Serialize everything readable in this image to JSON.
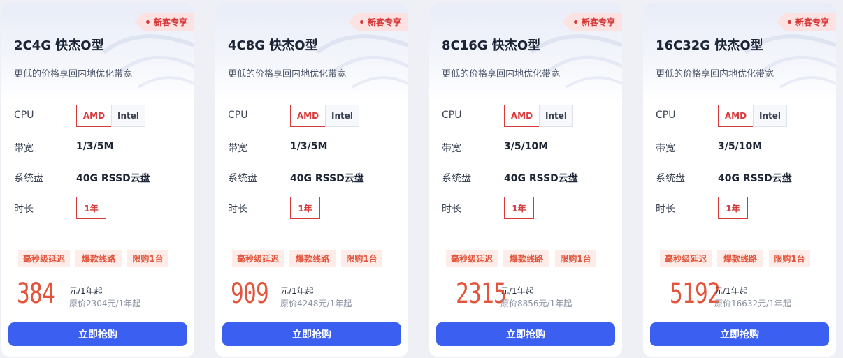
{
  "labels": {
    "cpu": "CPU",
    "bandwidth": "带宽",
    "disk": "系统盘",
    "duration": "时长"
  },
  "colors": {
    "accent_red": "#d63a3a",
    "price_orange": "#e2553c",
    "button_blue": "#3b5ff0",
    "tag_bg": "#fdece7",
    "badge_bg": "#fde2e2"
  },
  "cards": [
    {
      "badge": "新客专享",
      "title": "2C4G 快杰O型",
      "subtitle": "更低的价格享回内地优化带宽",
      "cpu_options": [
        "AMD",
        "Intel"
      ],
      "cpu_selected": "AMD",
      "bandwidth": "1/3/5M",
      "disk": "40G RSSD云盘",
      "duration": "1年",
      "tags": [
        "毫秒级延迟",
        "爆款线路",
        "限购1台"
      ],
      "price": "384",
      "unit": "元/1年起",
      "original": "原价2304元/1年起",
      "button": "立即抢购"
    },
    {
      "badge": "新客专享",
      "title": "4C8G 快杰O型",
      "subtitle": "更低的价格享回内地优化带宽",
      "cpu_options": [
        "AMD",
        "Intel"
      ],
      "cpu_selected": "AMD",
      "bandwidth": "1/3/5M",
      "disk": "40G RSSD云盘",
      "duration": "1年",
      "tags": [
        "毫秒级延迟",
        "爆款线路",
        "限购1台"
      ],
      "price": "909",
      "unit": "元/1年起",
      "original": "原价4248元/1年起",
      "button": "立即抢购"
    },
    {
      "badge": "新客专享",
      "title": "8C16G 快杰O型",
      "subtitle": "更低的价格享回内地优化带宽",
      "cpu_options": [
        "AMD",
        "Intel"
      ],
      "cpu_selected": "AMD",
      "bandwidth": "3/5/10M",
      "disk": "40G RSSD云盘",
      "duration": "1年",
      "tags": [
        "毫秒级延迟",
        "爆款线路",
        "限购1台"
      ],
      "price": "2315",
      "unit": "元/1年起",
      "original": "原价8856元/1年起",
      "button": "立即抢购"
    },
    {
      "badge": "新客专享",
      "title": "16C32G 快杰O型",
      "subtitle": "更低的价格享回内地优化带宽",
      "cpu_options": [
        "AMD",
        "Intel"
      ],
      "cpu_selected": "AMD",
      "bandwidth": "3/5/10M",
      "disk": "40G RSSD云盘",
      "duration": "1年",
      "tags": [
        "毫秒级延迟",
        "爆款线路",
        "限购1台"
      ],
      "price": "5192",
      "unit": "元/1年起",
      "original": "原价16632元/1年起",
      "button": "立即抢购"
    }
  ]
}
